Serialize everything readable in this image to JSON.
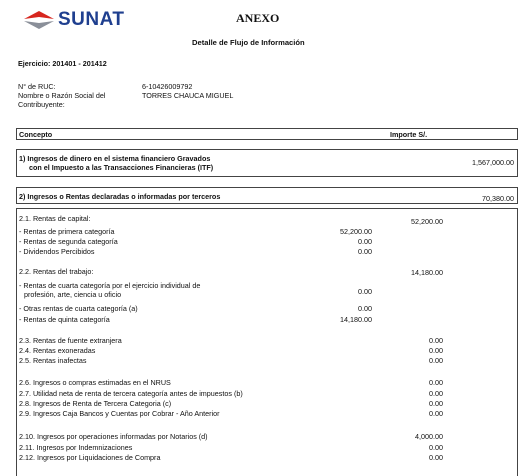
{
  "header": {
    "logo_text": "SUNAT",
    "title": "ANEXO",
    "subtitle": "Detalle de Flujo de Información"
  },
  "ejercicio": "Ejercicio: 201401 - 201412",
  "ruc_label": "N° de RUC:",
  "ruc_value": "6-10426009792",
  "nombre_label_1": "Nombre o Razón Social del",
  "nombre_label_2": "Contribuyente:",
  "nombre_value": "TORRES CHAUCA MIGUEL",
  "table_header": {
    "concepto": "Concepto",
    "importe": "Importe  S/."
  },
  "section1": {
    "line1": "1) Ingresos de dinero en el sistema financiero Gravados",
    "line2": "con el Impuesto a las Transacciones Financieras (ITF)",
    "amount": "1,567,000.00"
  },
  "section2": {
    "title": "2) Ingresos o Rentas declaradas o informadas por terceros",
    "amount": "70,380.00"
  },
  "rows": {
    "r21_label": "2.1. Rentas de capital:",
    "r21_amount": "52,200.00",
    "r211_label": "- Rentas de primera categoría",
    "r211_amount": "52,200.00",
    "r212_label": "- Rentas de segunda categoría",
    "r212_amount": "0.00",
    "r213_label": "- Dividendos Percibidos",
    "r213_amount": "0.00",
    "r22_label": "2.2. Rentas del trabajo:",
    "r22_amount": "14,180.00",
    "r221_label_1": "- Rentas de cuarta categoría por el ejercicio individual de",
    "r221_label_2": "profesión, arte, ciencia u oficio",
    "r221_amount": "0.00",
    "r222_label": "- Otras rentas de cuarta categoría (a)",
    "r222_amount": "0.00",
    "r223_label": "- Rentas de quinta categoría",
    "r223_amount": "14,180.00",
    "r23_label": "2.3. Rentas de fuente extranjera",
    "r23_amount": "0.00",
    "r24_label": "2.4. Rentas exoneradas",
    "r24_amount": "0.00",
    "r25_label": "2.5. Rentas inafectas",
    "r25_amount": "0.00",
    "r26_label": "2.6. Ingresos o compras estimadas en el NRUS",
    "r26_amount": "0.00",
    "r27_label": "2.7. Utilidad neta de renta de tercera categoría antes de impuestos (b)",
    "r27_amount": "0.00",
    "r28_label": "2.8. Ingresos de Renta de Tercera Categoria (c)",
    "r28_amount": "0.00",
    "r29_label": "2.9. Ingresos Caja Bancos y Cuentas por Cobrar - Año Anterior",
    "r29_amount": "0.00",
    "r210_label": "2.10. Ingresos por operaciones informadas por Notarios (d)",
    "r210_amount": "4,000.00",
    "r211b_label": "2.11. Ingresos por Indemnizaciones",
    "r211b_amount": "0.00",
    "r212b_label": "2.12. Ingresos por Liquidaciones de Compra",
    "r212b_amount": "0.00"
  },
  "colors": {
    "logo_blue": "#1f3f8f",
    "logo_red": "#d7261e",
    "logo_gray": "#8a8f99"
  }
}
